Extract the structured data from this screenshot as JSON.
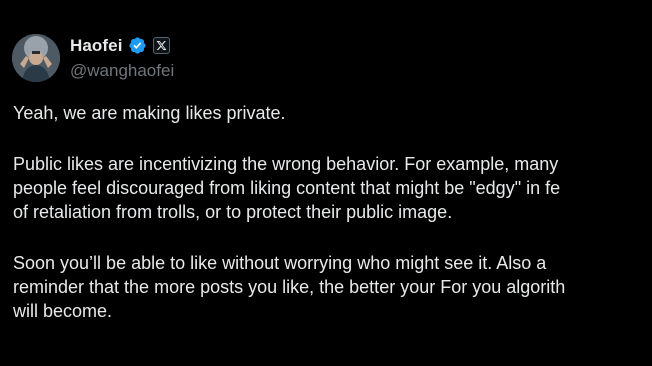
{
  "author": {
    "display_name": "Haofei",
    "handle": "@wanghaofei",
    "verified": true,
    "verified_color": "#1d9bf0",
    "affiliate_icon": "x-logo-icon"
  },
  "tweet": {
    "paragraph_1": [
      "Yeah, we are making likes private."
    ],
    "paragraph_2": [
      "Public likes are incentivizing the wrong behavior. For example, many",
      "people feel discouraged from liking content that might be \"edgy\" in fe",
      "of retaliation from trolls, or to protect their public image."
    ],
    "paragraph_3": [
      "Soon you’ll be able to like without worrying who might see it. Also a",
      "reminder that the more posts you like, the better your For you algorith",
      "will become."
    ]
  },
  "colors": {
    "background": "#000000",
    "text": "#e7e9ea",
    "secondary_text": "#71767b"
  }
}
